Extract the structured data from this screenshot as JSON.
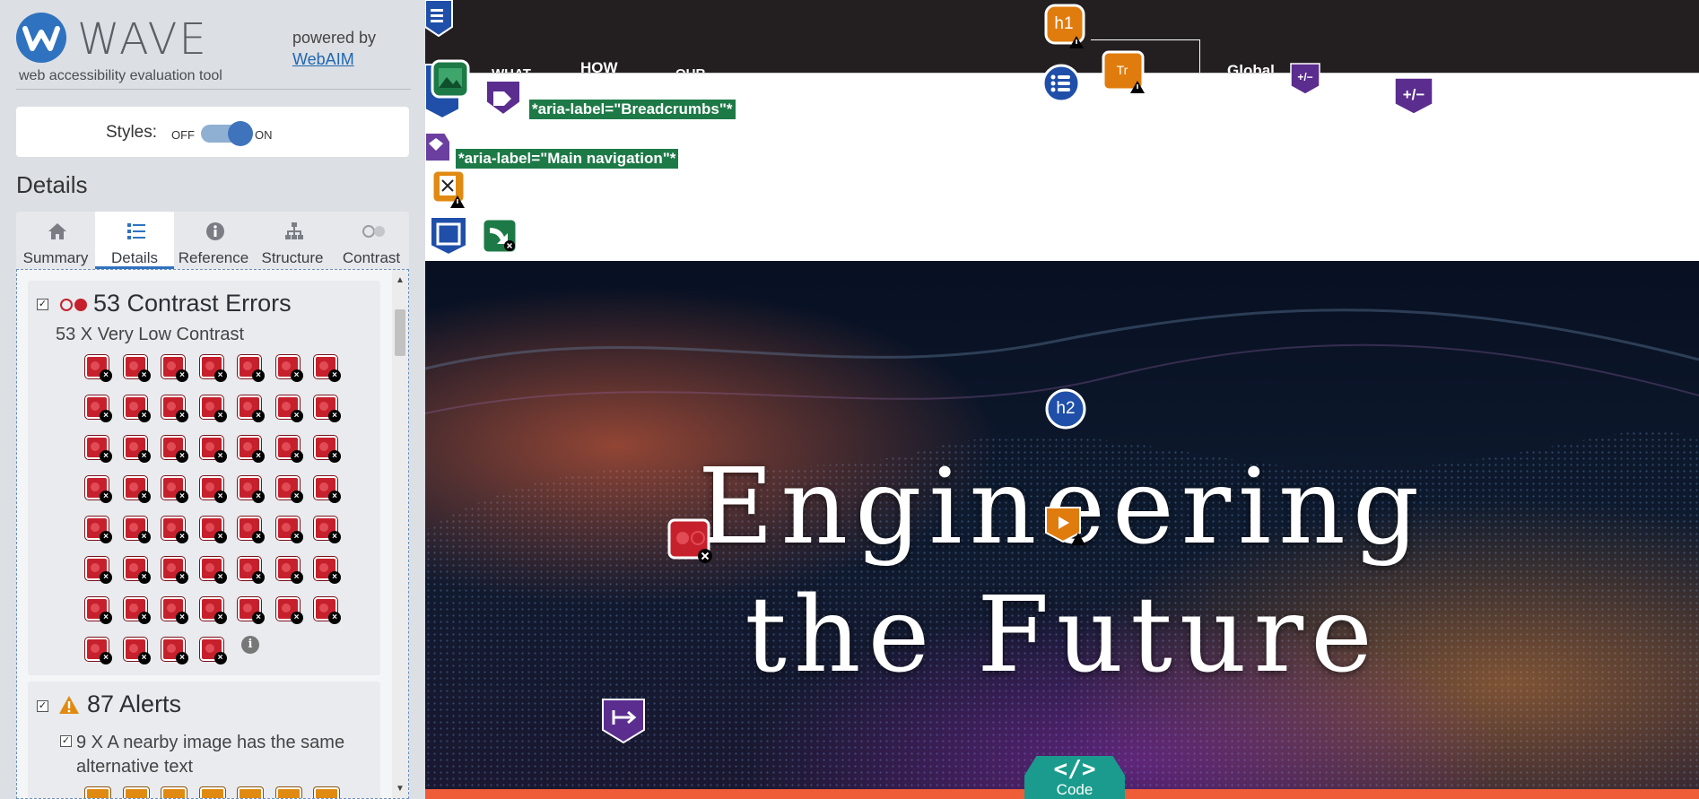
{
  "brand": {
    "title": "WAVE",
    "subtitle": "web accessibility evaluation tool",
    "powered_by": "powered by",
    "link": "WebAIM"
  },
  "styles_toggle": {
    "label": "Styles:",
    "off": "OFF",
    "on": "ON",
    "state": "on"
  },
  "details_heading": "Details",
  "tabs": [
    {
      "label": "Summary",
      "icon": "home-icon"
    },
    {
      "label": "Details",
      "icon": "list-icon",
      "active": true
    },
    {
      "label": "Reference",
      "icon": "info-icon"
    },
    {
      "label": "Structure",
      "icon": "structure-icon"
    },
    {
      "label": "Contrast",
      "icon": "contrast-icon"
    }
  ],
  "contrast_section": {
    "checked": true,
    "title": "53 Contrast Errors",
    "item": "53 X Very Low Contrast",
    "count": 53
  },
  "alerts_section": {
    "checked": true,
    "title": "87 Alerts",
    "item": "9 X A nearby image has the same alternative text",
    "count": 9
  },
  "preview": {
    "nav": [
      "WHAT",
      "HOW",
      "OUR",
      "Global"
    ],
    "aria_tags": [
      "*aria-label=\"Breadcrumbs\"*",
      "*aria-label=\"Main navigation\"*"
    ],
    "hero_line_1": "Engineering",
    "hero_line_2": "the Future",
    "code_button": {
      "glyph": "</>",
      "label": "Code"
    },
    "icons": {
      "h1": "h1",
      "h2": "h2",
      "text_size": "Tr",
      "toggle": "+/−"
    }
  },
  "colors": {
    "wave_blue": "#2f72bf",
    "error_red": "#c6202c",
    "alert_orange": "#e08a12",
    "aria_green": "#1d7a47",
    "feature_purple": "#6b3fa0",
    "code_teal": "#1a9b8d"
  }
}
